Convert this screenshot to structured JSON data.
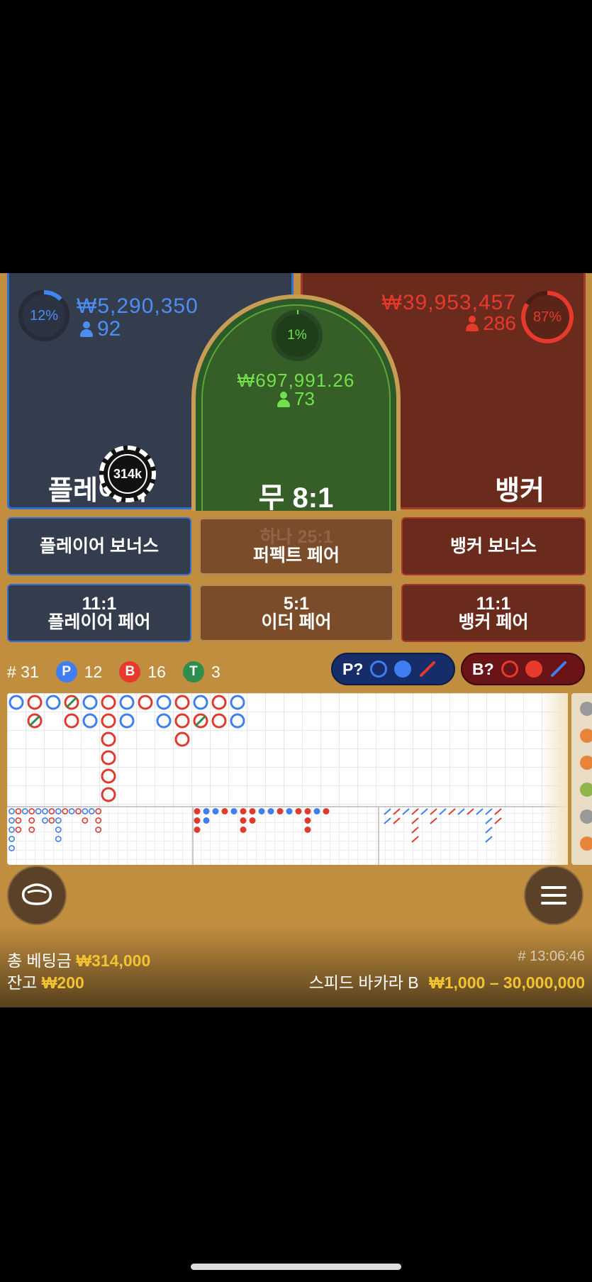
{
  "player": {
    "percent": "12%",
    "amount": "₩5,290,350",
    "players": "92",
    "label": "플레이어",
    "color": "#4d8ef5"
  },
  "tie": {
    "percent": "1%",
    "amount": "₩697,991.26",
    "players": "73",
    "label": "무 8:1",
    "color": "#74e04d"
  },
  "banker": {
    "percent": "87%",
    "amount": "₩39,953,457",
    "players": "286",
    "label": "뱅커",
    "color": "#e8392d"
  },
  "chip": {
    "value": "314k"
  },
  "side_bets": {
    "player_bonus": "플레이어 보너스",
    "perfect_pair_ghost": "하나 25:1",
    "perfect_pair": "퍼펙트 페어",
    "banker_bonus": "뱅커 보너스",
    "player_pair_odds": "11:1",
    "player_pair": "플레이어 페어",
    "either_pair_odds": "5:1",
    "either_pair": "이더 페어",
    "banker_pair_odds": "11:1",
    "banker_pair": "뱅커 페어"
  },
  "stats": {
    "round": "# 31",
    "p_badge": "P",
    "p_count": "12",
    "b_badge": "B",
    "b_count": "16",
    "t_badge": "T",
    "t_count": "3"
  },
  "predict": {
    "player": "P?",
    "banker": "B?"
  },
  "footer": {
    "total_bet_label": "총 베팅금",
    "total_bet": "₩314,000",
    "balance_label": "잔고",
    "balance": "₩200",
    "round_time": "# 13:06:46",
    "table_name": "스피드 바카라 B",
    "limits": "₩1,000 – 30,000,000"
  },
  "icons": {
    "chat": "chat-icon",
    "menu": "menu-icon"
  }
}
